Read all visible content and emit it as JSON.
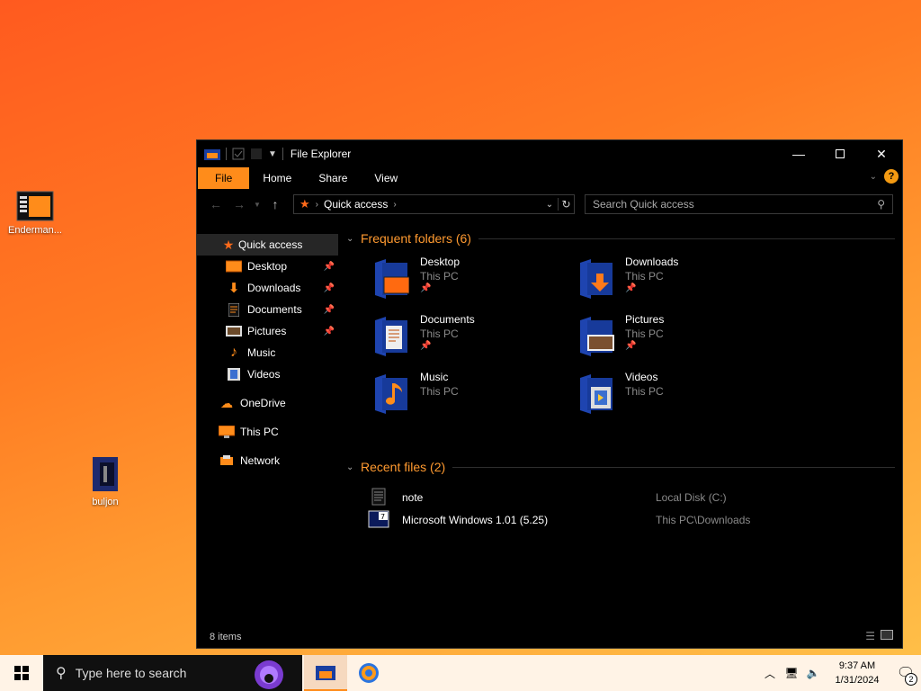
{
  "desktop": {
    "icons": [
      {
        "label": "Enderman..."
      },
      {
        "label": "buljon"
      }
    ]
  },
  "window": {
    "title": "File Explorer",
    "ribbon_tabs": [
      "File",
      "Home",
      "Share",
      "View"
    ],
    "address": {
      "location": "Quick access"
    },
    "search": {
      "placeholder": "Search Quick access"
    },
    "sidebar": {
      "items": [
        {
          "label": "Quick access"
        },
        {
          "label": "Desktop"
        },
        {
          "label": "Downloads"
        },
        {
          "label": "Documents"
        },
        {
          "label": "Pictures"
        },
        {
          "label": "Music"
        },
        {
          "label": "Videos"
        },
        {
          "label": "OneDrive"
        },
        {
          "label": "This PC"
        },
        {
          "label": "Network"
        }
      ]
    },
    "frequent": {
      "heading": "Frequent folders (6)",
      "folders": [
        {
          "name": "Desktop",
          "location": "This PC"
        },
        {
          "name": "Downloads",
          "location": "This PC"
        },
        {
          "name": "Documents",
          "location": "This PC"
        },
        {
          "name": "Pictures",
          "location": "This PC"
        },
        {
          "name": "Music",
          "location": "This PC"
        },
        {
          "name": "Videos",
          "location": "This PC"
        }
      ]
    },
    "recent": {
      "heading": "Recent files (2)",
      "files": [
        {
          "name": "note",
          "location": "Local Disk (C:)"
        },
        {
          "name": "Microsoft Windows 1.01 (5.25)",
          "location": "This PC\\Downloads"
        }
      ]
    },
    "status": "8 items"
  },
  "taskbar": {
    "search_placeholder": "Type here to search",
    "time": "9:37 AM",
    "date": "1/31/2024",
    "notification_count": "2"
  },
  "colors": {
    "accent": "#ff8c1a",
    "window_bg": "#000000",
    "taskbar_bg": "#fff3e6"
  }
}
